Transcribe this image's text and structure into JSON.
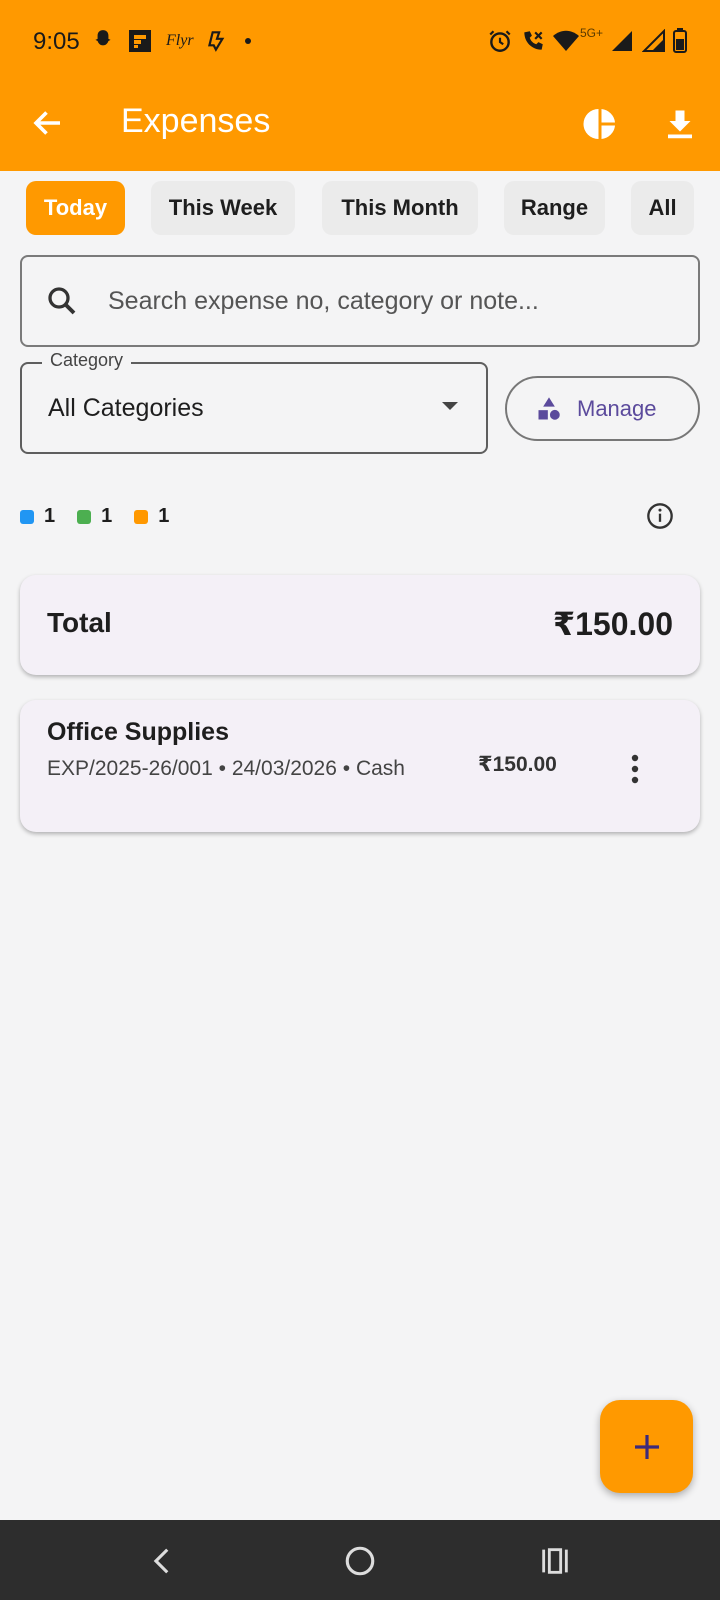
{
  "status_bar": {
    "time": "9:05",
    "network": "5G+",
    "icons": [
      "snapchat-icon",
      "flipboard-icon",
      "flyr-icon",
      "chat-icon",
      "alarm-icon",
      "wifi-call-icon",
      "wifi-icon",
      "signal-icon",
      "signal-icon",
      "battery-icon"
    ],
    "flyr_text": "Flyr"
  },
  "appbar": {
    "title": "Expenses",
    "color": "#ff9900"
  },
  "filters": [
    {
      "label": "Today",
      "active": true
    },
    {
      "label": "This Week",
      "active": false
    },
    {
      "label": "This Month",
      "active": false
    },
    {
      "label": "Range",
      "active": false
    },
    {
      "label": "All",
      "active": false
    }
  ],
  "search": {
    "placeholder": "Search expense no, category or note...",
    "value": ""
  },
  "category": {
    "label": "Category",
    "selected": "All Categories"
  },
  "manage_label": "Manage",
  "legend": [
    {
      "color": "#2196f3",
      "count": "1"
    },
    {
      "color": "#4caf50",
      "count": "1"
    },
    {
      "color": "#ff9800",
      "count": "1"
    }
  ],
  "summary": {
    "total_label": "Total",
    "total_value": "₹150.00"
  },
  "expenses": [
    {
      "name": "Office Supplies",
      "meta": "EXP/2025-26/001 • 24/03/2026 • Cash",
      "amount": "₹150.00"
    }
  ],
  "accent_color": "#ff9900"
}
